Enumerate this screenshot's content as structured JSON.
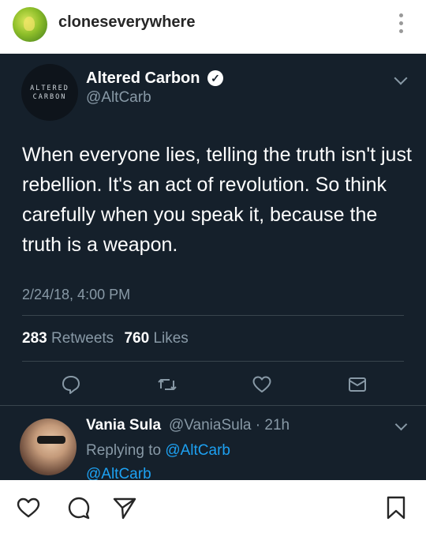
{
  "instagram": {
    "username": "cloneseverywhere"
  },
  "tweet": {
    "avatar_text_line1": "ALTERED",
    "avatar_text_line2": "CARBON",
    "display_name": "Altered Carbon",
    "handle": "@AltCarb",
    "text": "When everyone lies, telling the truth isn't just rebellion. It's an act of revolution. So think carefully when you speak it, because the truth is a weapon.",
    "timestamp": "2/24/18, 4:00 PM",
    "retweets_count": "283",
    "retweets_label": "Retweets",
    "likes_count": "760",
    "likes_label": "Likes"
  },
  "reply": {
    "name": "Vania Sula",
    "meta": "@VaniaSula · 21h",
    "replying_prefix": "Replying to",
    "replying_to": "@AltCarb",
    "second_line": "@AltCarb"
  },
  "icons": {
    "tweet_actions": [
      "reply-icon",
      "retweet-icon",
      "like-icon",
      "message-icon"
    ],
    "ig_actions": [
      "heart-icon",
      "comment-icon",
      "share-icon",
      "bookmark-icon"
    ]
  },
  "colors": {
    "tweet_background": "#15202b",
    "secondary_text": "#8899a6",
    "link": "#1da1f2"
  }
}
